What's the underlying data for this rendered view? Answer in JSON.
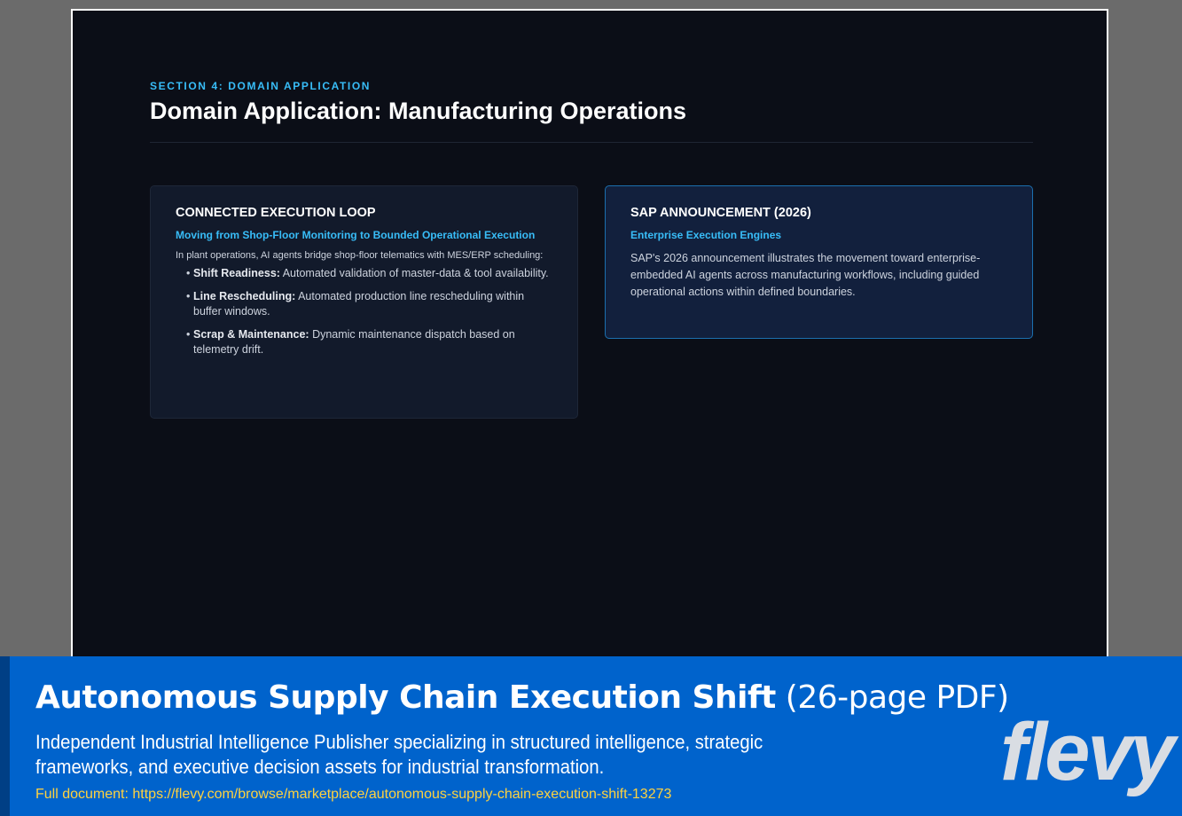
{
  "slide": {
    "section_label": "SECTION 4: DOMAIN APPLICATION",
    "title": "Domain Application: Manufacturing Operations",
    "left_card": {
      "title": "CONNECTED EXECUTION LOOP",
      "subtitle": "Moving from Shop-Floor Monitoring to Bounded Operational Execution",
      "intro": "In plant operations, AI agents bridge shop-floor telematics with MES/ERP scheduling:",
      "bullets": [
        {
          "lead": "Shift Readiness:",
          "text": " Automated validation of master-data & tool availability."
        },
        {
          "lead": "Line Rescheduling:",
          "text": " Automated production line rescheduling within buffer windows."
        },
        {
          "lead": "Scrap & Maintenance:",
          "text": " Dynamic maintenance dispatch based on telemetry drift."
        }
      ]
    },
    "right_card": {
      "title": "SAP ANNOUNCEMENT (2026)",
      "subtitle": "Enterprise Execution Engines",
      "body": "SAP's 2026 announcement illustrates the movement toward enterprise-embedded AI agents across manufacturing workflows, including guided operational actions within defined boundaries."
    }
  },
  "banner": {
    "title_bold": "Autonomous Supply Chain Execution Shift",
    "title_suffix": " (26-page PDF)",
    "description": "Independent Industrial Intelligence Publisher specializing in structured intelligence, strategic frameworks, and executive decision assets for industrial transformation.",
    "link_text": "Full document: https://flevy.com/browse/marketplace/autonomous-supply-chain-execution-shift-13273",
    "logo": "flevy"
  }
}
